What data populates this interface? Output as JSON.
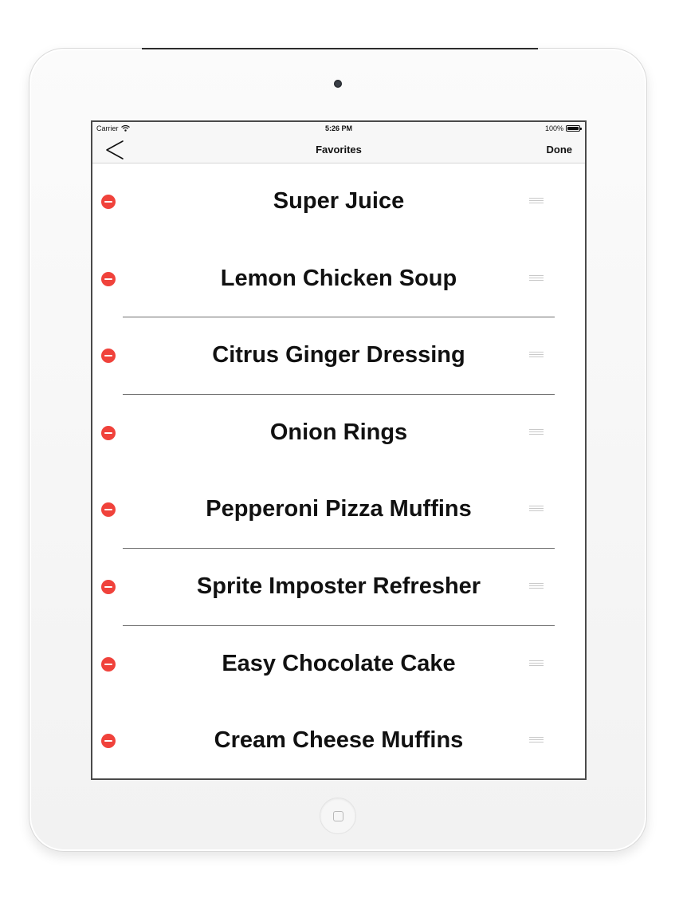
{
  "status_bar": {
    "carrier": "Carrier",
    "time": "5:26 PM",
    "battery": "100%",
    "battery_level": 1.0
  },
  "nav": {
    "back_icon": "chevron-left-icon",
    "title": "Favorites",
    "done_label": "Done"
  },
  "colors": {
    "delete": "#f0423b",
    "separator": "#6e6e6e",
    "handle": "#c9c9c9"
  },
  "favorites": [
    {
      "title": "Super Juice",
      "separator": false
    },
    {
      "title": "Lemon Chicken Soup",
      "separator": true
    },
    {
      "title": "Citrus Ginger Dressing",
      "separator": true
    },
    {
      "title": "Onion Rings",
      "separator": false
    },
    {
      "title": "Pepperoni Pizza Muffins",
      "separator": true
    },
    {
      "title": "Sprite Imposter Refresher",
      "separator": true
    },
    {
      "title": "Easy Chocolate Cake",
      "separator": false
    },
    {
      "title": "Cream Cheese Muffins",
      "separator": false
    }
  ]
}
